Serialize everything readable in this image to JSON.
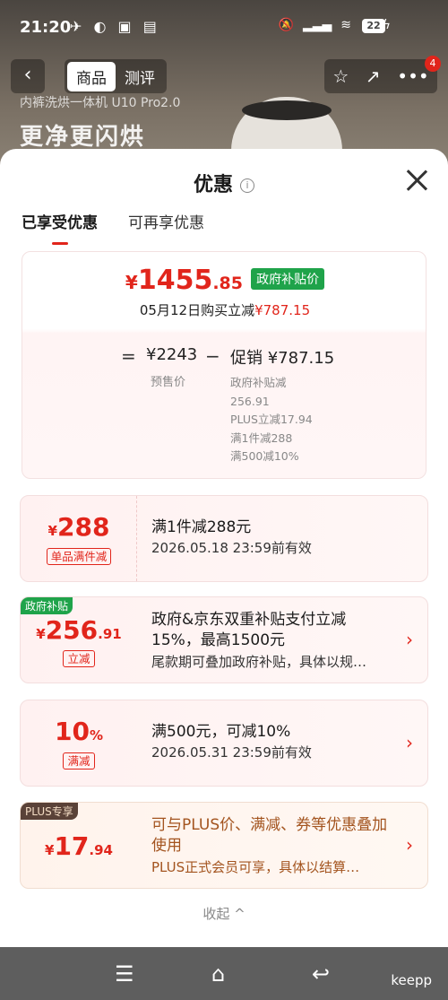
{
  "status_bar": {
    "time": "21:20",
    "battery": "22"
  },
  "product_header": {
    "back_icon": "chevron-left-icon",
    "tabs": [
      "商品",
      "测评"
    ],
    "subtitle": "内裤洗烘一体机 U10 Pro2.0",
    "headline": "更净更闪烘",
    "badge_count": "4"
  },
  "sheet": {
    "title": "优惠",
    "tabs": [
      "已享受优惠",
      "可再享优惠"
    ],
    "summary": {
      "yen": "¥",
      "price_int": "1455",
      "price_dec": ".85",
      "price_tag": "政府补贴价",
      "date_text": "05月12日购买立减",
      "date_amount": "¥787.15",
      "eq": "=",
      "presale_price": "¥2243",
      "presale_label": "预售价",
      "minus": "−",
      "promo_text": "促销 ¥787.15",
      "promo_items": [
        "政府补贴减",
        "256.91",
        "PLUS立减17.94",
        "满1件减288",
        "满500减10%"
      ]
    },
    "cards": [
      {
        "corner": "",
        "yen": "¥",
        "amount_int": "288",
        "amount_dec": "",
        "label": "单品满件减",
        "main": "满1件减288元",
        "sub": "2026.05.18 23:59前有效"
      },
      {
        "corner": "政府补贴",
        "yen": "¥",
        "amount_int": "256",
        "amount_dec": ".91",
        "label": "立减",
        "main": "政府&京东双重补贴支付立减15%，最高1500元",
        "sub": "尾款期可叠加政府补贴，具体以规…"
      },
      {
        "corner": "",
        "yen": "",
        "amount_int": "10",
        "amount_dec": "%",
        "label": "满减",
        "main": "满500元，可减10%",
        "sub": "2026.05.31 23:59前有效"
      },
      {
        "corner": "PLUS专享",
        "yen": "¥",
        "amount_int": "17",
        "amount_dec": ".94",
        "label": "",
        "main": "可与PLUS价、满减、券等优惠叠加使用",
        "sub": "PLUS正式会员可享，具体以结算…"
      }
    ],
    "collapse_label": "收起 ^"
  },
  "system_nav": {
    "watermark": "keepp"
  },
  "colors": {
    "accent": "#e1251b",
    "gov_green": "#1fa34a",
    "plus_dark": "#5a4238",
    "plus_text": "#a3541f"
  }
}
